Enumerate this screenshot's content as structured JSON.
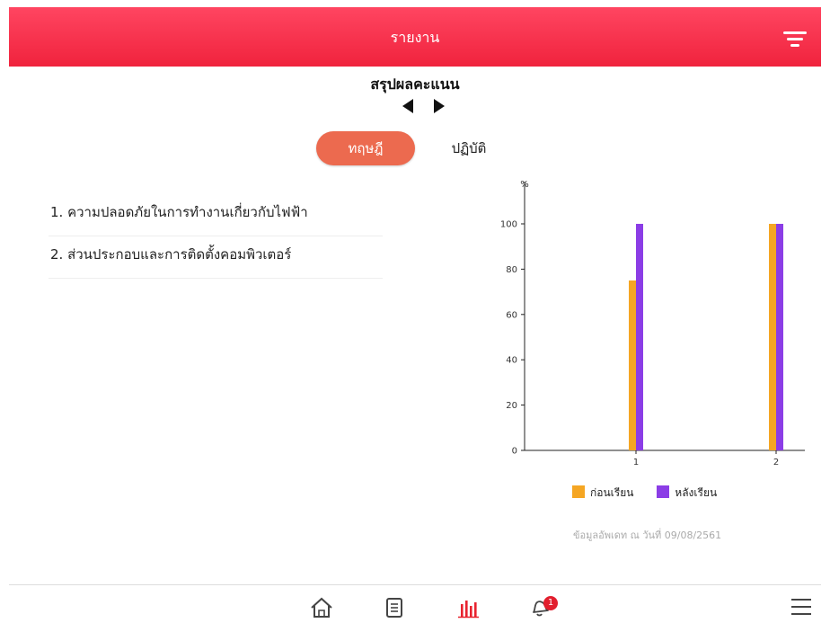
{
  "header": {
    "title": "รายงาน",
    "filter_icon": "filter-icon"
  },
  "subtitle": "สรุปผลคะแนน",
  "tabs": [
    {
      "label": "ทฤษฎี",
      "active": true
    },
    {
      "label": "ปฏิบัติ",
      "active": false
    }
  ],
  "topics": [
    {
      "text": "1. ความปลอดภัยในการทำงานเกี่ยวกับไฟฟ้า"
    },
    {
      "text": "2. ส่วนประกอบและการติดตั้งคอมพิวเตอร์"
    }
  ],
  "chart_data": {
    "type": "bar",
    "ylabel": "%",
    "ylim": [
      0,
      100
    ],
    "yticks": [
      "0",
      "20",
      "40",
      "60",
      "80",
      "100"
    ],
    "categories": [
      "1",
      "2"
    ],
    "series": [
      {
        "name": "ก่อนเรียน",
        "color": "#f5a623",
        "values": [
          75,
          100
        ]
      },
      {
        "name": "หลังเรียน",
        "color": "#8b3de6",
        "values": [
          100,
          100
        ]
      }
    ],
    "legend": "bottom"
  },
  "updated_text": "ข้อมูลอัพเดท ณ วันที่ 09/08/2561",
  "bottom_nav": {
    "items": [
      "home-icon",
      "document-icon",
      "chart-icon",
      "bell-icon"
    ],
    "active": "chart-icon",
    "notification_count": "1",
    "menu_icon": "menu-icon"
  },
  "colors": {
    "header": "#f0233d",
    "active_tab": "#ec6a4f",
    "active_nav": "#e8232f"
  }
}
